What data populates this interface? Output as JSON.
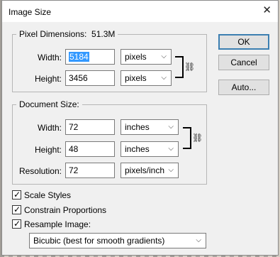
{
  "window": {
    "title": "Image Size",
    "close_glyph": "✕"
  },
  "pixel_dimensions": {
    "legend": "Pixel Dimensions:",
    "size": "51.3M",
    "width": {
      "label": "Width:",
      "value": "5184",
      "unit": "pixels"
    },
    "height": {
      "label": "Height:",
      "value": "3456",
      "unit": "pixels"
    }
  },
  "document_size": {
    "legend": "Document Size:",
    "width": {
      "label": "Width:",
      "value": "72",
      "unit": "inches"
    },
    "height": {
      "label": "Height:",
      "value": "48",
      "unit": "inches"
    },
    "resolution": {
      "label": "Resolution:",
      "value": "72",
      "unit": "pixels/inch"
    }
  },
  "buttons": {
    "ok": "OK",
    "cancel": "Cancel",
    "auto": "Auto..."
  },
  "options": {
    "scale_styles": {
      "label": "Scale Styles",
      "checked": true
    },
    "constrain_proportions": {
      "label": "Constrain Proportions",
      "checked": true
    },
    "resample_image": {
      "label": "Resample Image:",
      "checked": true
    }
  },
  "resample_method": "Bicubic (best for smooth gradients)",
  "icons": {
    "chain": "chain-link-icon",
    "dropdown": "chevron-down-icon",
    "check": "checkmark-icon"
  },
  "colors": {
    "selection": "#3399ff",
    "default_button_border": "#3c7fb1"
  }
}
